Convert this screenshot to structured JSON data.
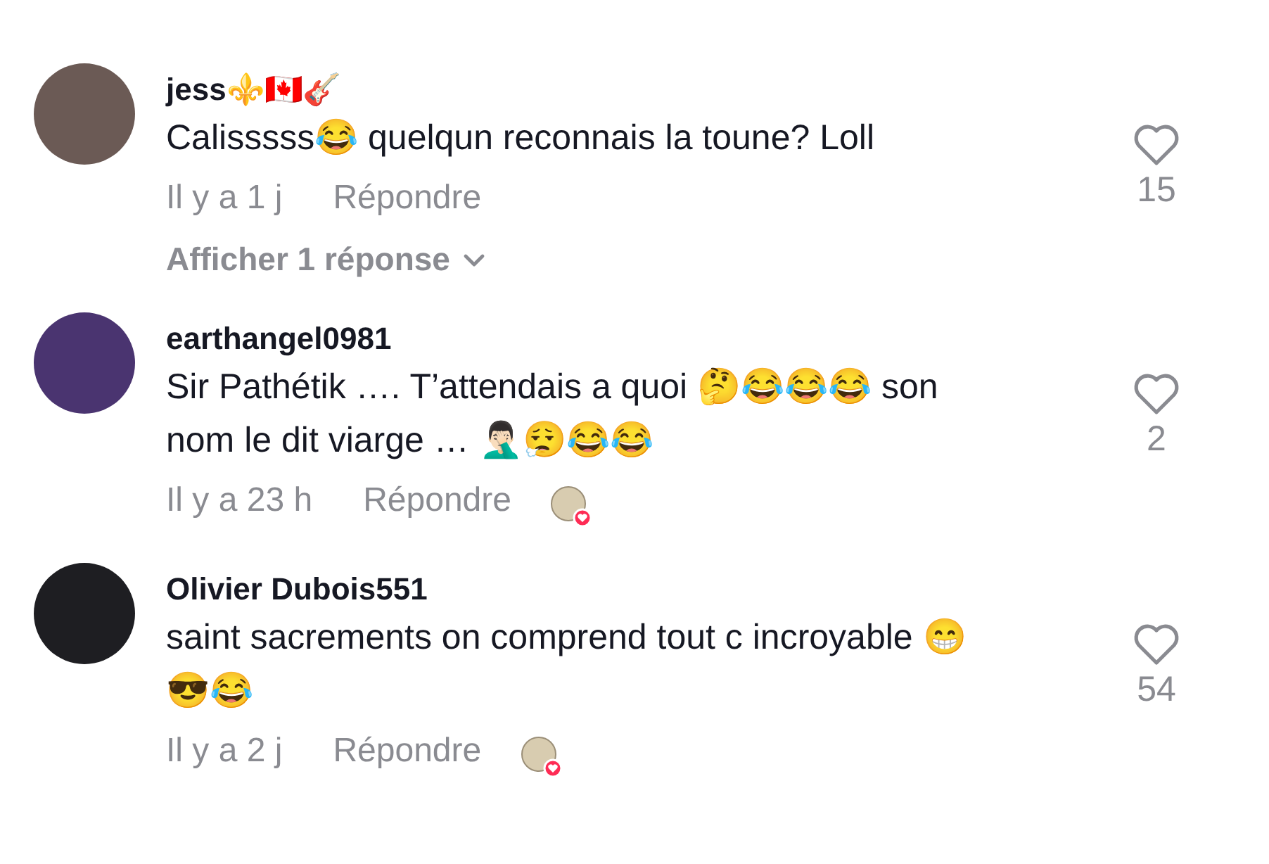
{
  "comments": [
    {
      "author": "jess⚜️🇨🇦🎸",
      "text": "Calisssss😂 quelqun reconnais la toune? Loll",
      "time": "Il y a 1 j",
      "reply_label": "Répondre",
      "likes": "15",
      "liked_by_creator": false,
      "replies_label": "Afficher 1 réponse"
    },
    {
      "author": "earthangel0981",
      "text": "Sir Pathétik …. T’attendais a quoi 🤔😂😂😂 son nom le dit viarge … 🤦🏻‍♂️😮‍💨😂😂",
      "time": "Il y a 23 h",
      "reply_label": "Répondre",
      "likes": "2",
      "liked_by_creator": true
    },
    {
      "author": "Olivier Dubois551",
      "text": "saint sacrements on comprend tout c incroyable 😁 😎😂",
      "time": "Il y a 2 j",
      "reply_label": "Répondre",
      "likes": "54",
      "liked_by_creator": true
    }
  ]
}
